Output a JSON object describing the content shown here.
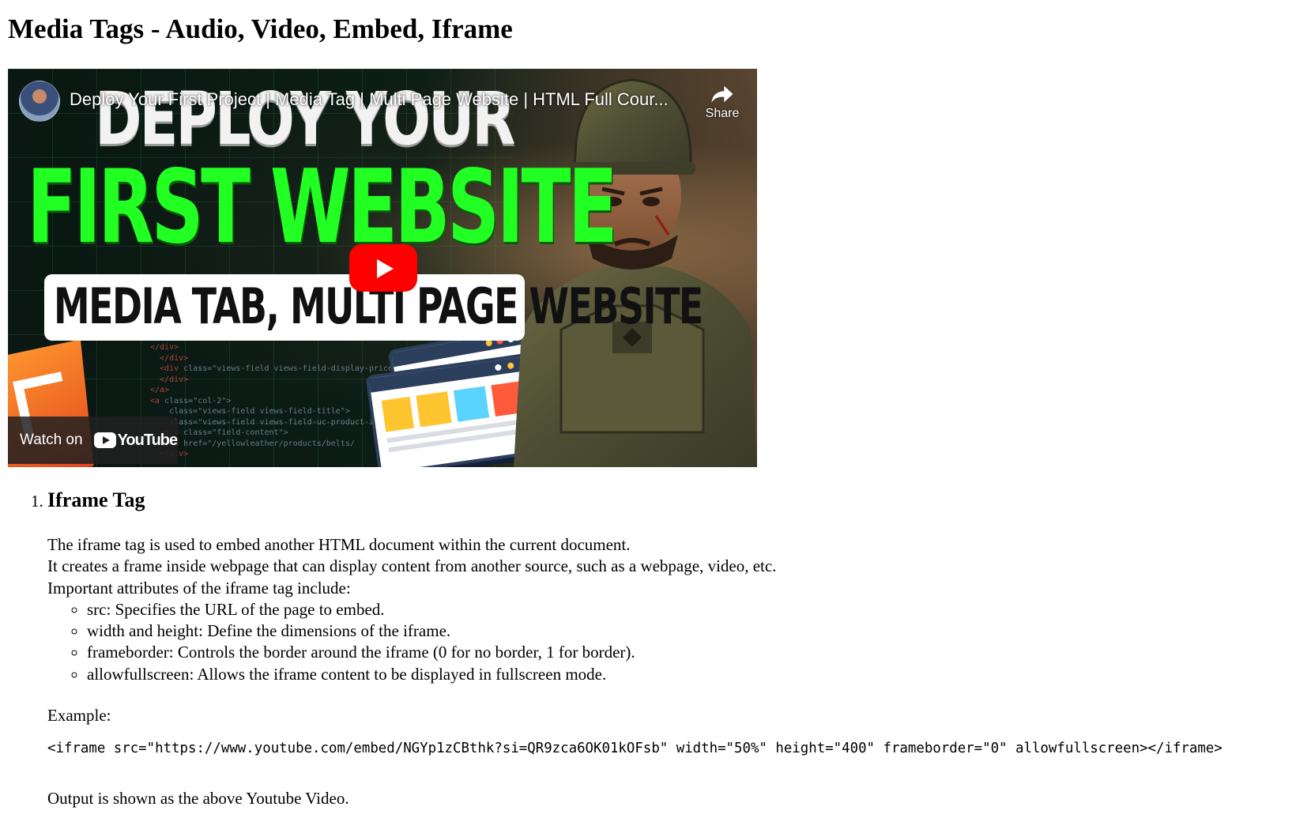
{
  "page": {
    "title": "Media Tags - Audio, Video, Embed, Iframe"
  },
  "video": {
    "title": "Deploy Your First Project | Media Tag | Multi Page Website | HTML Full Cour...",
    "share_label": "Share",
    "watch_on_label": "Watch on",
    "youtube_logo_text": "YouTube",
    "thumbnail_text": {
      "line1": "DEPLOY YOUR",
      "line2": "FIRST WEBSITE",
      "line3": "MEDIA TAB, MULTI PAGE WEBSITE"
    },
    "colors": {
      "play_button": "#ff0000",
      "headline_green": "#22ff22"
    }
  },
  "section": {
    "number": "1.",
    "heading": "Iframe Tag",
    "paragraph_lines": [
      "The iframe tag is used to embed another HTML document within the current document.",
      "It creates a frame inside webpage that can display content from another source, such as a webpage, video, etc.",
      "Important attributes of the iframe tag include:"
    ],
    "attributes": [
      "src: Specifies the URL of the page to embed.",
      "width and height: Define the dimensions of the iframe.",
      "frameborder: Controls the border around the iframe (0 for no border, 1 for border).",
      "allowfullscreen: Allows the iframe content to be displayed in fullscreen mode."
    ],
    "example_label": "Example:",
    "example_code": "<iframe src=\"https://www.youtube.com/embed/NGYp1zCBthk?si=QR9zca6OK01kOFsb\" width=\"50%\" height=\"400\" frameborder=\"0\" allowfullscreen></iframe>",
    "output_note": "Output is shown as the above Youtube Video."
  }
}
